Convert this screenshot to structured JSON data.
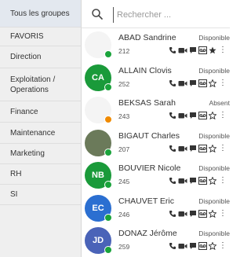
{
  "sidebar": {
    "groups": [
      {
        "label": "Tous les groupes"
      },
      {
        "label": "FAVORIS"
      },
      {
        "label": "Direction"
      },
      {
        "label": "Exploitation / Operations"
      },
      {
        "label": "Finance"
      },
      {
        "label": "Maintenance"
      },
      {
        "label": "Marketing"
      },
      {
        "label": "RH"
      },
      {
        "label": "SI"
      }
    ]
  },
  "search": {
    "placeholder": "Rechercher ...",
    "value": ""
  },
  "contacts": [
    {
      "name": "ABAD Sandrine",
      "ext": "212",
      "status": "Disponible",
      "avatar_initials": "",
      "avatar_color": "#f4f4f4",
      "status_color": "#1aa33b",
      "favorite": true
    },
    {
      "name": "ALLAIN Clovis",
      "ext": "252",
      "status": "Disponible",
      "avatar_initials": "CA",
      "avatar_color": "#1a9a3a",
      "status_color": "#1aa33b",
      "favorite": false
    },
    {
      "name": "BEKSAS Sarah",
      "ext": "243",
      "status": "Absent",
      "avatar_initials": "",
      "avatar_color": "#f4f4f4",
      "status_color": "#f08a00",
      "favorite": false
    },
    {
      "name": "BIGAUT Charles",
      "ext": "207",
      "status": "Disponible",
      "avatar_initials": "",
      "avatar_color": "#6b7a5a",
      "status_color": "#1aa33b",
      "favorite": false
    },
    {
      "name": "BOUVIER Nicole",
      "ext": "245",
      "status": "Disponible",
      "avatar_initials": "NB",
      "avatar_color": "#1a9a3a",
      "status_color": "#1aa33b",
      "favorite": false
    },
    {
      "name": "CHAUVET Eric",
      "ext": "246",
      "status": "Disponible",
      "avatar_initials": "EC",
      "avatar_color": "#2b6fd1",
      "status_color": "#1aa33b",
      "favorite": false
    },
    {
      "name": "DONAZ Jérôme",
      "ext": "259",
      "status": "Disponible",
      "avatar_initials": "JD",
      "avatar_color": "#4a63b8",
      "status_color": "#1aa33b",
      "favorite": false
    }
  ]
}
